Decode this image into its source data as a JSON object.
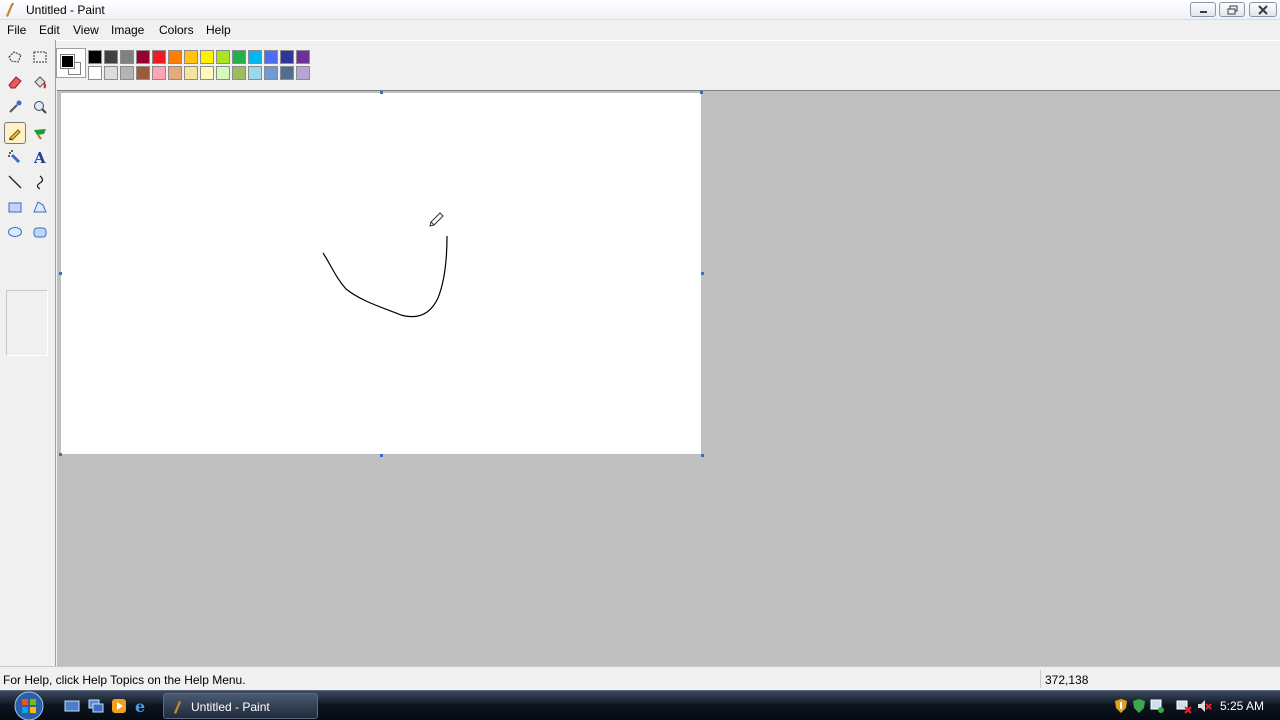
{
  "window": {
    "title": "Untitled - Paint"
  },
  "menu": {
    "file": "File",
    "edit": "Edit",
    "view": "View",
    "image": "Image",
    "colors": "Colors",
    "help": "Help"
  },
  "tools": [
    {
      "name": "free-form-select-icon"
    },
    {
      "name": "select-icon"
    },
    {
      "name": "eraser-icon"
    },
    {
      "name": "fill-icon"
    },
    {
      "name": "pick-color-icon"
    },
    {
      "name": "magnifier-icon"
    },
    {
      "name": "pencil-icon",
      "active": true
    },
    {
      "name": "brush-icon"
    },
    {
      "name": "airbrush-icon"
    },
    {
      "name": "text-icon"
    },
    {
      "name": "line-icon"
    },
    {
      "name": "curve-icon"
    },
    {
      "name": "rectangle-icon"
    },
    {
      "name": "polygon-icon"
    },
    {
      "name": "ellipse-icon"
    },
    {
      "name": "rounded-rectangle-icon"
    }
  ],
  "palette": {
    "foreground": "#000000",
    "background": "#ffffff",
    "row1": [
      "#000000",
      "#404040",
      "#808080",
      "#990030",
      "#ed1c24",
      "#ff7e00",
      "#ffc20e",
      "#fff200",
      "#a8e61d",
      "#22b14c",
      "#00b7ef",
      "#4d6df3",
      "#2f3699",
      "#6f3198"
    ],
    "row2": [
      "#ffffff",
      "#dcdcdc",
      "#b4b4b4",
      "#9c5a3c",
      "#ffa3b1",
      "#e5aa7a",
      "#f5e49c",
      "#fff9bd",
      "#d3f9bc",
      "#9dbb61",
      "#99d9ea",
      "#709ad1",
      "#546d8e",
      "#b5a5d5"
    ]
  },
  "status": {
    "help_text": "For Help, click Help Topics on the Help Menu.",
    "coordinates": "372,138"
  },
  "taskbar": {
    "task_label": "Untitled - Paint",
    "clock": "5:25 AM"
  }
}
